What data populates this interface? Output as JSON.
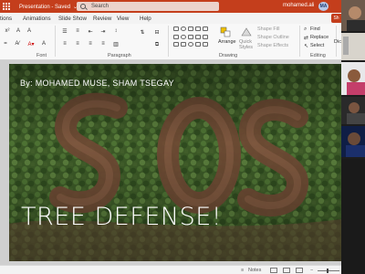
{
  "app": {
    "title_text": "Presentation - Saved",
    "title_caret": "⌄",
    "search_placeholder": "Search",
    "user_name": "mohamed.ali",
    "user_initials": "MA",
    "brand_color": "#c43e1c"
  },
  "tabs": [
    "tions",
    "Animations",
    "Slide Show",
    "Review",
    "View",
    "Help"
  ],
  "share_label": "Sh",
  "ribbon": {
    "groups": {
      "font": "Font",
      "paragraph": "Paragraph",
      "drawing": "Drawing",
      "editing": "Editing"
    },
    "arrange_label": "Arrange",
    "quick_styles_line1": "Quick",
    "quick_styles_line2": "Styles",
    "shape_fill": "Shape Fill",
    "shape_outline": "Shape Outline",
    "shape_effects": "Shape Effects",
    "find": "Find",
    "replace": "Replace",
    "select": "Select",
    "dictate_short": "Dic"
  },
  "slide": {
    "byline": "By: MOHAMED MUSE, SHAM TSEGAY",
    "headline": "TREE DEFENSE!",
    "background_desc_color": "#3f5f2a"
  },
  "statusbar": {
    "notes": "Notes",
    "zoom_minus": "−",
    "zoom_plus": "+"
  },
  "icons": {
    "waffle": "app-launcher-icon",
    "search": "search-icon",
    "font_color": "font-color-icon",
    "shapes": "shapes-gallery-icon",
    "find": "find-icon"
  }
}
